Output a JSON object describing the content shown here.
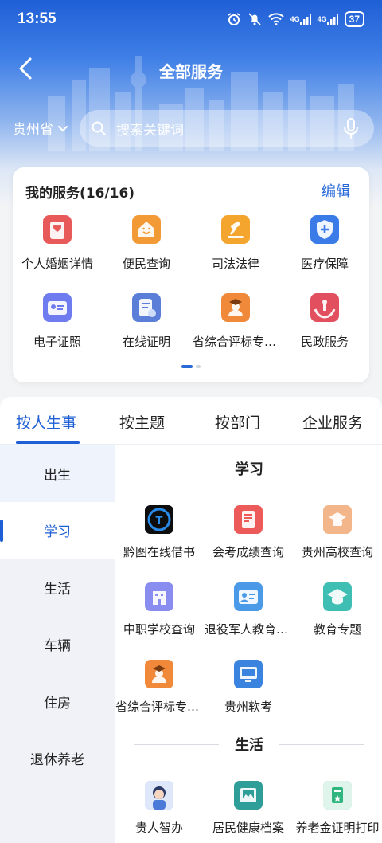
{
  "status": {
    "time": "13:55",
    "battery": "37",
    "net1": "4G",
    "net2": "4G"
  },
  "nav": {
    "title": "全部服务"
  },
  "location": {
    "province": "贵州省"
  },
  "search": {
    "placeholder": "搜索关键词"
  },
  "my_services": {
    "title": "我的服务(16/16)",
    "edit": "编辑",
    "items": [
      {
        "label": "个人婚姻详情",
        "icon": "marriage-certificate-icon",
        "color": "#e8595a"
      },
      {
        "label": "便民查询",
        "icon": "smiling-house-icon",
        "color": "#f29a35"
      },
      {
        "label": "司法法律",
        "icon": "gavel-icon",
        "color": "#f4a52e"
      },
      {
        "label": "医疗保障",
        "icon": "medical-shield-icon",
        "color": "#3a7be8"
      },
      {
        "label": "电子证照",
        "icon": "id-card-icon",
        "color": "#6f7cf0"
      },
      {
        "label": "在线证明",
        "icon": "document-icon",
        "color": "#5b7fd8"
      },
      {
        "label": "省综合评标专家库",
        "icon": "expert-graduate-icon",
        "color": "#f08a3a"
      },
      {
        "label": "民政服务",
        "icon": "hands-people-icon",
        "color": "#e2505f"
      }
    ]
  },
  "tabs": [
    {
      "label": "按人生事",
      "active": true
    },
    {
      "label": "按主题",
      "active": false
    },
    {
      "label": "按部门",
      "active": false
    },
    {
      "label": "企业服务",
      "active": false
    }
  ],
  "sidebar": [
    {
      "label": "出生"
    },
    {
      "label": "学习"
    },
    {
      "label": "生活"
    },
    {
      "label": "车辆"
    },
    {
      "label": "住房"
    },
    {
      "label": "退休养老"
    }
  ],
  "sections": [
    {
      "title": "学习",
      "items": [
        {
          "label": "黔图在线借书",
          "icon": "qiantu-logo-icon",
          "color": "#1a3a7a"
        },
        {
          "label": "会考成绩查询",
          "icon": "score-report-icon",
          "color": "#ec5a5a"
        },
        {
          "label": "贵州高校查询",
          "icon": "college-icon",
          "color": "#f3b58a"
        },
        {
          "label": "中职学校查询",
          "icon": "school-building-icon",
          "color": "#8a8df0"
        },
        {
          "label": "退役军人教育培训",
          "icon": "veteran-card-icon",
          "color": "#4a9ae8"
        },
        {
          "label": "教育专题",
          "icon": "graduation-cap-icon",
          "color": "#3fbfb4"
        },
        {
          "label": "省综合评标专家库",
          "icon": "expert-graduate-icon",
          "color": "#f08a3a"
        },
        {
          "label": "贵州软考",
          "icon": "computer-monitor-icon",
          "color": "#3a84e0"
        }
      ]
    },
    {
      "title": "生活",
      "items": [
        {
          "label": "贵人智办",
          "icon": "avatar-mascot-icon",
          "color": "#4a7ad8"
        },
        {
          "label": "居民健康档案",
          "icon": "health-record-icon",
          "color": "#2f9d98"
        },
        {
          "label": "养老金证明打印",
          "icon": "pension-certificate-icon",
          "color": "#2fb57e"
        }
      ]
    }
  ]
}
